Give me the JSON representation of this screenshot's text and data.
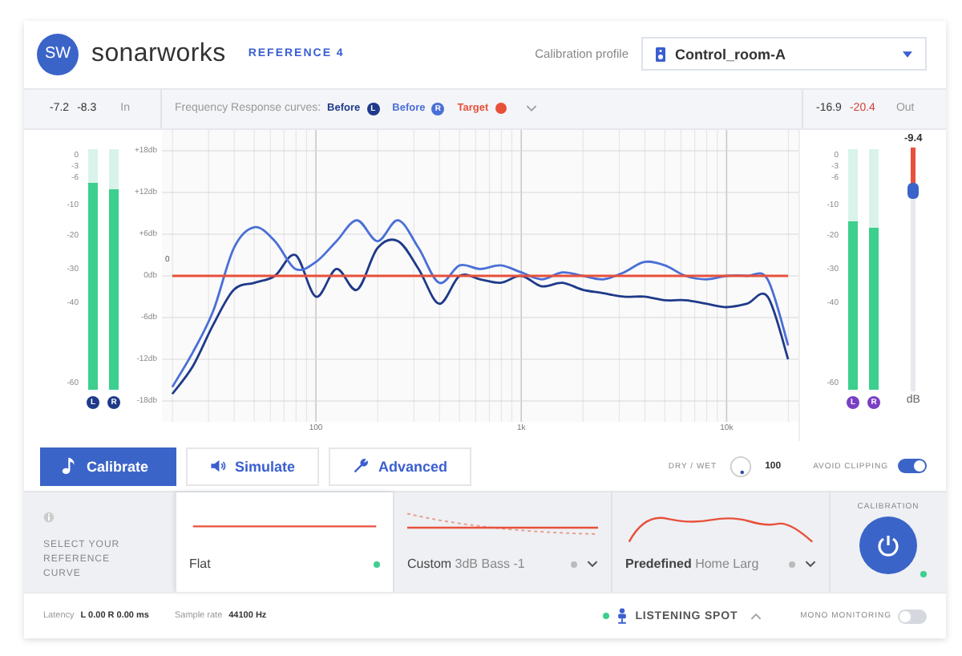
{
  "header": {
    "logo_text": "SW",
    "brand": "sonarworks",
    "product": "REFERENCE 4",
    "profile_label": "Calibration profile",
    "profile_value": "Control_room-A"
  },
  "input": {
    "reading_l": "-7.2",
    "reading_r": "-8.3",
    "label": "In"
  },
  "legend": {
    "label": "Frequency Response curves:",
    "items": [
      {
        "text": "Before",
        "badge": "L",
        "color": "#1f3a8a"
      },
      {
        "text": "Before",
        "badge": "R",
        "color": "#4a6fd6"
      },
      {
        "text": "Target",
        "color": "#e8503a"
      }
    ]
  },
  "output": {
    "reading_l": "-16.9",
    "reading_r": "-20.4",
    "label": "Out"
  },
  "input_meters": {
    "scale": [
      "0",
      "-3",
      "-6",
      "-10",
      "-20",
      "-30",
      "-40",
      "-60"
    ],
    "channels": [
      {
        "badge": "L",
        "level": 0.86
      },
      {
        "badge": "R",
        "level": 0.83
      }
    ]
  },
  "chart": {
    "target_marker": "0",
    "chart_data": {
      "type": "line",
      "categories": [
        null,
        null,
        null,
        null,
        null,
        null,
        null,
        "100",
        null,
        null,
        null,
        null,
        null,
        null,
        null,
        null,
        null,
        "1k",
        null,
        null,
        null,
        null,
        null,
        null,
        null,
        null,
        null,
        "10k",
        null,
        null,
        null
      ],
      "series": [
        {
          "color": "#1f3a8a",
          "values": [
            -17,
            -13,
            -7,
            -2,
            -1,
            0,
            3,
            -3,
            1,
            -2,
            4,
            5,
            1,
            -4,
            0,
            -0.5,
            -1,
            0,
            -1.5,
            -1,
            -2,
            -2.5,
            -3,
            -3,
            -3.5,
            -3.5,
            -4,
            -4.5,
            -4,
            -3,
            -12
          ]
        },
        {
          "color": "#4a6fd6",
          "values": [
            -16,
            -11,
            -5,
            4,
            7,
            5,
            1,
            2,
            5,
            8,
            5,
            8,
            4,
            -1,
            1.5,
            1,
            1.5,
            0.5,
            -0.5,
            0.5,
            0,
            -0.5,
            0.5,
            2,
            1.5,
            0,
            -0.5,
            0,
            0,
            -0.5,
            -10
          ]
        },
        {
          "color": "#e8503a",
          "values": [
            0,
            0,
            0,
            0,
            0,
            0,
            0,
            0,
            0,
            0,
            0,
            0,
            0,
            0,
            0,
            0,
            0,
            0,
            0,
            0,
            0,
            0,
            0,
            0,
            0,
            0,
            0,
            0,
            0,
            0,
            0
          ]
        }
      ],
      "ylim": [
        -21,
        21
      ],
      "grid": true,
      "yticks": [
        {
          "value": 18,
          "label": "+18db"
        },
        {
          "value": 12,
          "label": "+12db"
        },
        {
          "value": 6,
          "label": "+6db"
        },
        {
          "value": 0,
          "label": "0db"
        },
        {
          "value": -6,
          "label": "-6db"
        },
        {
          "value": -12,
          "label": "-12db"
        },
        {
          "value": -18,
          "label": "-18db"
        }
      ]
    }
  },
  "output_meters": {
    "scale": [
      "0",
      "-3",
      "-6",
      "-10",
      "-20",
      "-30",
      "-40",
      "-60"
    ],
    "channels": [
      {
        "badge": "L",
        "level": 0.7
      },
      {
        "badge": "R",
        "level": 0.67
      }
    ],
    "gain": {
      "reading": "-9.4",
      "level": 0.82,
      "unit": "dB"
    }
  },
  "modes": [
    {
      "label": "Calibrate",
      "selected": true
    },
    {
      "label": "Simulate",
      "selected": false
    },
    {
      "label": "Advanced",
      "selected": false
    }
  ],
  "dry_wet": {
    "label": "DRY / WET",
    "value": "100"
  },
  "avoid_clipping": {
    "label": "AVOID CLIPPING",
    "on": true
  },
  "reference": {
    "title": "SELECT YOUR REFERENCE CURVE",
    "curves": [
      {
        "kind": "flat",
        "name": "Flat",
        "selected": true,
        "active": true
      },
      {
        "kind": "custom",
        "name": "Custom",
        "detail": "3dB Bass -1",
        "selected": false,
        "active": false
      },
      {
        "kind": "predefined",
        "name": "Predefined",
        "detail": "Home Larg",
        "selected": false,
        "active": false
      }
    ]
  },
  "calibration": {
    "label": "CALIBRATION",
    "on": true
  },
  "status": {
    "latency_label": "Latency",
    "latency_value": "L 0.00 R 0.00 ms",
    "sample_rate_label": "Sample rate",
    "sample_rate_value": "44100 Hz",
    "listening_spot": "LISTENING SPOT",
    "listening_spot_active": true,
    "mono_label": "MONO MONITORING",
    "mono_on": false
  }
}
